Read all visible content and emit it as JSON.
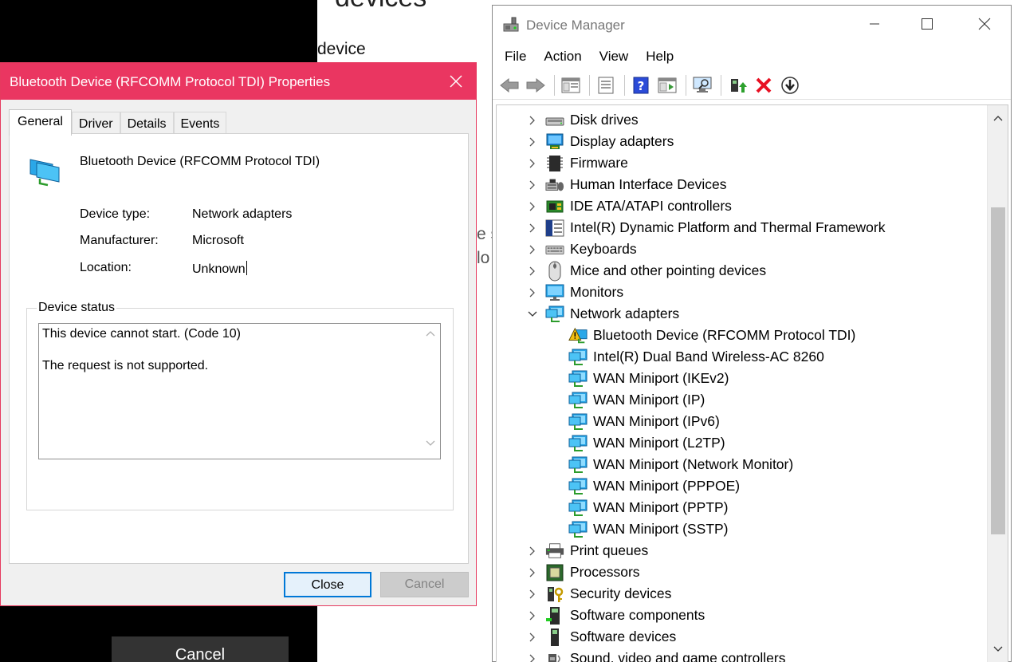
{
  "background": {
    "heading_fragment": "devices",
    "device_fragment": "device",
    "text_fragment_1": "e s",
    "text_fragment_2": "lo",
    "cancel_label": "Cancel"
  },
  "device_manager": {
    "title": "Device Manager",
    "menu": [
      "File",
      "Action",
      "View",
      "Help"
    ],
    "toolbar_icons": [
      "back-arrow-icon",
      "forward-arrow-icon",
      "console-tree-icon",
      "properties-icon",
      "help-icon",
      "action-pane-icon",
      "scan-hardware-icon",
      "update-driver-icon",
      "uninstall-icon",
      "disable-device-icon"
    ],
    "tree": [
      {
        "label": "Disk drives",
        "icon": "disk-drive-icon",
        "level": 0,
        "expanded": false
      },
      {
        "label": "Display adapters",
        "icon": "display-adapter-icon",
        "level": 0,
        "expanded": false
      },
      {
        "label": "Firmware",
        "icon": "firmware-icon",
        "level": 0,
        "expanded": false
      },
      {
        "label": "Human Interface Devices",
        "icon": "hid-icon",
        "level": 0,
        "expanded": false
      },
      {
        "label": "IDE ATA/ATAPI controllers",
        "icon": "ide-controller-icon",
        "level": 0,
        "expanded": false
      },
      {
        "label": "Intel(R) Dynamic Platform and Thermal Framework",
        "icon": "intel-dptf-icon",
        "level": 0,
        "expanded": false
      },
      {
        "label": "Keyboards",
        "icon": "keyboard-icon",
        "level": 0,
        "expanded": false
      },
      {
        "label": "Mice and other pointing devices",
        "icon": "mouse-icon",
        "level": 0,
        "expanded": false
      },
      {
        "label": "Monitors",
        "icon": "monitor-icon",
        "level": 0,
        "expanded": false
      },
      {
        "label": "Network adapters",
        "icon": "network-adapter-icon",
        "level": 0,
        "expanded": true
      },
      {
        "label": "Bluetooth Device (RFCOMM Protocol TDI)",
        "icon": "warning-icon",
        "level": 1
      },
      {
        "label": "Intel(R) Dual Band Wireless-AC 8260",
        "icon": "network-adapter-icon",
        "level": 1
      },
      {
        "label": "WAN Miniport (IKEv2)",
        "icon": "network-adapter-icon",
        "level": 1
      },
      {
        "label": "WAN Miniport (IP)",
        "icon": "network-adapter-icon",
        "level": 1
      },
      {
        "label": "WAN Miniport (IPv6)",
        "icon": "network-adapter-icon",
        "level": 1
      },
      {
        "label": "WAN Miniport (L2TP)",
        "icon": "network-adapter-icon",
        "level": 1
      },
      {
        "label": "WAN Miniport (Network Monitor)",
        "icon": "network-adapter-icon",
        "level": 1
      },
      {
        "label": "WAN Miniport (PPPOE)",
        "icon": "network-adapter-icon",
        "level": 1
      },
      {
        "label": "WAN Miniport (PPTP)",
        "icon": "network-adapter-icon",
        "level": 1
      },
      {
        "label": "WAN Miniport (SSTP)",
        "icon": "network-adapter-icon",
        "level": 1
      },
      {
        "label": "Print queues",
        "icon": "printer-icon",
        "level": 0,
        "expanded": false
      },
      {
        "label": "Processors",
        "icon": "processor-icon",
        "level": 0,
        "expanded": false
      },
      {
        "label": "Security devices",
        "icon": "security-device-icon",
        "level": 0,
        "expanded": false
      },
      {
        "label": "Software components",
        "icon": "software-component-icon",
        "level": 0,
        "expanded": false
      },
      {
        "label": "Software devices",
        "icon": "software-device-icon",
        "level": 0,
        "expanded": false
      },
      {
        "label": "Sound, video and game controllers",
        "icon": "sound-icon",
        "level": 0,
        "expanded": false
      }
    ]
  },
  "properties": {
    "title": "Bluetooth Device (RFCOMM Protocol TDI) Properties",
    "tabs": [
      "General",
      "Driver",
      "Details",
      "Events"
    ],
    "active_tab": "General",
    "device_name": "Bluetooth Device (RFCOMM Protocol TDI)",
    "fields": [
      {
        "label": "Device type:",
        "value": "Network adapters"
      },
      {
        "label": "Manufacturer:",
        "value": "Microsoft"
      },
      {
        "label": "Location:",
        "value": "Unknown"
      }
    ],
    "status_group_label": "Device status",
    "status_line_1": "This device cannot start. (Code 10)",
    "status_line_2": "The request is not supported.",
    "close_label": "Close",
    "cancel_label": "Cancel"
  },
  "colors": {
    "dialog_title_bar": "#ea3661",
    "close_button_border": "#0078d7",
    "warning": "#f2c012",
    "uninstall_red": "#e81123"
  }
}
